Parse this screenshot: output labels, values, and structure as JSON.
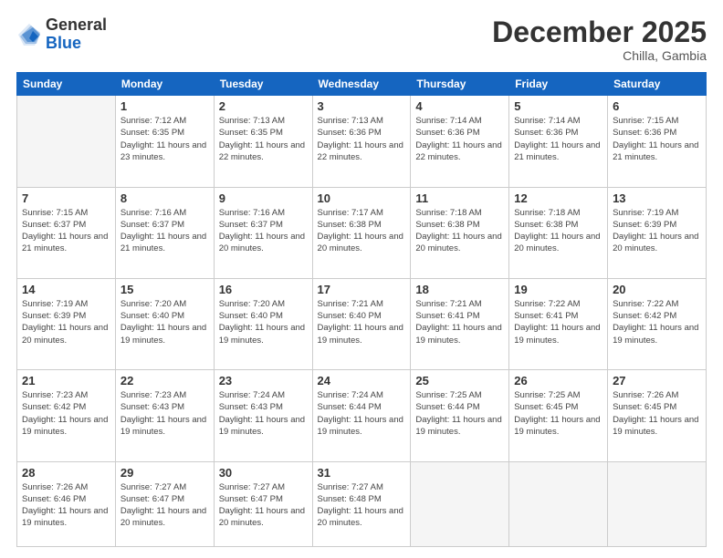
{
  "header": {
    "logo": {
      "general": "General",
      "blue": "Blue"
    },
    "title": "December 2025",
    "subtitle": "Chilla, Gambia"
  },
  "weekdays": [
    "Sunday",
    "Monday",
    "Tuesday",
    "Wednesday",
    "Thursday",
    "Friday",
    "Saturday"
  ],
  "weeks": [
    [
      {
        "day": "",
        "empty": true
      },
      {
        "day": "1",
        "sunrise": "7:12 AM",
        "sunset": "6:35 PM",
        "daylight": "11 hours and 23 minutes."
      },
      {
        "day": "2",
        "sunrise": "7:13 AM",
        "sunset": "6:35 PM",
        "daylight": "11 hours and 22 minutes."
      },
      {
        "day": "3",
        "sunrise": "7:13 AM",
        "sunset": "6:36 PM",
        "daylight": "11 hours and 22 minutes."
      },
      {
        "day": "4",
        "sunrise": "7:14 AM",
        "sunset": "6:36 PM",
        "daylight": "11 hours and 22 minutes."
      },
      {
        "day": "5",
        "sunrise": "7:14 AM",
        "sunset": "6:36 PM",
        "daylight": "11 hours and 21 minutes."
      },
      {
        "day": "6",
        "sunrise": "7:15 AM",
        "sunset": "6:36 PM",
        "daylight": "11 hours and 21 minutes."
      }
    ],
    [
      {
        "day": "7",
        "sunrise": "7:15 AM",
        "sunset": "6:37 PM",
        "daylight": "11 hours and 21 minutes."
      },
      {
        "day": "8",
        "sunrise": "7:16 AM",
        "sunset": "6:37 PM",
        "daylight": "11 hours and 21 minutes."
      },
      {
        "day": "9",
        "sunrise": "7:16 AM",
        "sunset": "6:37 PM",
        "daylight": "11 hours and 20 minutes."
      },
      {
        "day": "10",
        "sunrise": "7:17 AM",
        "sunset": "6:38 PM",
        "daylight": "11 hours and 20 minutes."
      },
      {
        "day": "11",
        "sunrise": "7:18 AM",
        "sunset": "6:38 PM",
        "daylight": "11 hours and 20 minutes."
      },
      {
        "day": "12",
        "sunrise": "7:18 AM",
        "sunset": "6:38 PM",
        "daylight": "11 hours and 20 minutes."
      },
      {
        "day": "13",
        "sunrise": "7:19 AM",
        "sunset": "6:39 PM",
        "daylight": "11 hours and 20 minutes."
      }
    ],
    [
      {
        "day": "14",
        "sunrise": "7:19 AM",
        "sunset": "6:39 PM",
        "daylight": "11 hours and 20 minutes."
      },
      {
        "day": "15",
        "sunrise": "7:20 AM",
        "sunset": "6:40 PM",
        "daylight": "11 hours and 19 minutes."
      },
      {
        "day": "16",
        "sunrise": "7:20 AM",
        "sunset": "6:40 PM",
        "daylight": "11 hours and 19 minutes."
      },
      {
        "day": "17",
        "sunrise": "7:21 AM",
        "sunset": "6:40 PM",
        "daylight": "11 hours and 19 minutes."
      },
      {
        "day": "18",
        "sunrise": "7:21 AM",
        "sunset": "6:41 PM",
        "daylight": "11 hours and 19 minutes."
      },
      {
        "day": "19",
        "sunrise": "7:22 AM",
        "sunset": "6:41 PM",
        "daylight": "11 hours and 19 minutes."
      },
      {
        "day": "20",
        "sunrise": "7:22 AM",
        "sunset": "6:42 PM",
        "daylight": "11 hours and 19 minutes."
      }
    ],
    [
      {
        "day": "21",
        "sunrise": "7:23 AM",
        "sunset": "6:42 PM",
        "daylight": "11 hours and 19 minutes."
      },
      {
        "day": "22",
        "sunrise": "7:23 AM",
        "sunset": "6:43 PM",
        "daylight": "11 hours and 19 minutes."
      },
      {
        "day": "23",
        "sunrise": "7:24 AM",
        "sunset": "6:43 PM",
        "daylight": "11 hours and 19 minutes."
      },
      {
        "day": "24",
        "sunrise": "7:24 AM",
        "sunset": "6:44 PM",
        "daylight": "11 hours and 19 minutes."
      },
      {
        "day": "25",
        "sunrise": "7:25 AM",
        "sunset": "6:44 PM",
        "daylight": "11 hours and 19 minutes."
      },
      {
        "day": "26",
        "sunrise": "7:25 AM",
        "sunset": "6:45 PM",
        "daylight": "11 hours and 19 minutes."
      },
      {
        "day": "27",
        "sunrise": "7:26 AM",
        "sunset": "6:45 PM",
        "daylight": "11 hours and 19 minutes."
      }
    ],
    [
      {
        "day": "28",
        "sunrise": "7:26 AM",
        "sunset": "6:46 PM",
        "daylight": "11 hours and 19 minutes."
      },
      {
        "day": "29",
        "sunrise": "7:27 AM",
        "sunset": "6:47 PM",
        "daylight": "11 hours and 20 minutes."
      },
      {
        "day": "30",
        "sunrise": "7:27 AM",
        "sunset": "6:47 PM",
        "daylight": "11 hours and 20 minutes."
      },
      {
        "day": "31",
        "sunrise": "7:27 AM",
        "sunset": "6:48 PM",
        "daylight": "11 hours and 20 minutes."
      },
      {
        "day": "",
        "empty": true
      },
      {
        "day": "",
        "empty": true
      },
      {
        "day": "",
        "empty": true
      }
    ]
  ]
}
